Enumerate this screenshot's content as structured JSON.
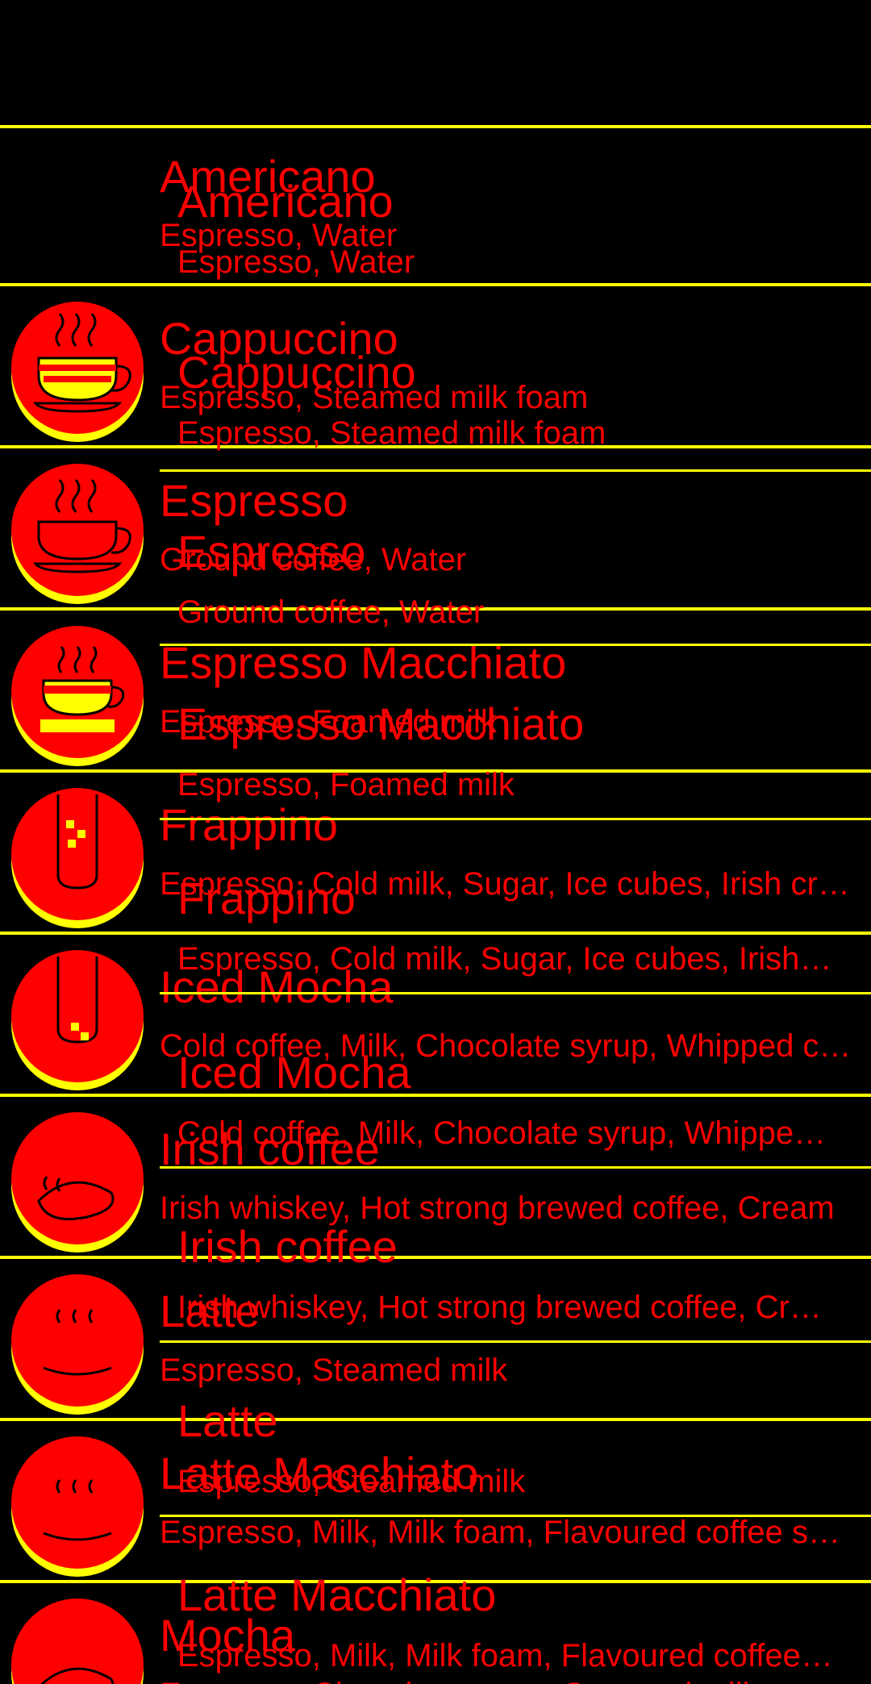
{
  "colors": {
    "background": "#000000",
    "text": "#ff0000",
    "divider": "#ffff00",
    "icon_fill": "#ff0000"
  },
  "coffees": [
    {
      "name": "Americano",
      "ingredients": "Espresso, Water",
      "icon": "no-icon"
    },
    {
      "name": "Cappuccino",
      "ingredients": "Espresso, Steamed milk foam",
      "icon": "cup-icon"
    },
    {
      "name": "Espresso",
      "ingredients": "Ground coffee, Water",
      "icon": "cup-icon"
    },
    {
      "name": "Espresso Macchiato",
      "ingredients": "Espresso, Foamed milk",
      "icon": "cup-icon"
    },
    {
      "name": "Frappino",
      "ingredients": "Espresso, Cold milk, Sugar, Ice cubes, Irish cream",
      "icon": "iced-glass-icon"
    },
    {
      "name": "Iced Mocha",
      "ingredients": "Cold coffee, Milk, Chocolate syrup, Whipped cream",
      "icon": "iced-glass-icon"
    },
    {
      "name": "Irish coffee",
      "ingredients": "Irish whiskey, Hot strong brewed coffee, Cream",
      "icon": "cup-icon"
    },
    {
      "name": "Latte",
      "ingredients": "Espresso, Steamed milk",
      "icon": "cup-icon"
    },
    {
      "name": "Latte Macchiato",
      "ingredients": "Espresso, Milk, Milk foam, Flavoured coffee syrup",
      "icon": "cup-icon"
    },
    {
      "name": "Mocha",
      "ingredients": "Espresso, Chocolate syrup, Steamed milk",
      "icon": "cup-icon"
    }
  ]
}
